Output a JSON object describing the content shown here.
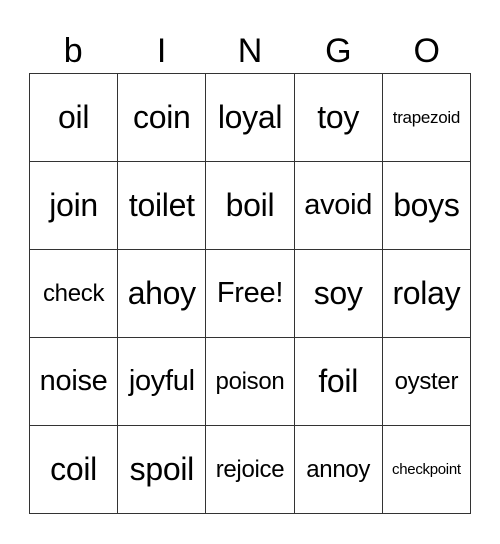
{
  "card": {
    "header": [
      "b",
      "I",
      "N",
      "G",
      "O"
    ],
    "rows": [
      [
        {
          "text": "oil",
          "size": "lg"
        },
        {
          "text": "coin",
          "size": "lg"
        },
        {
          "text": "loyal",
          "size": "lg"
        },
        {
          "text": "toy",
          "size": "lg"
        },
        {
          "text": "trapezoid",
          "size": "xs"
        }
      ],
      [
        {
          "text": "join",
          "size": "lg"
        },
        {
          "text": "toilet",
          "size": "lg"
        },
        {
          "text": "boil",
          "size": "lg"
        },
        {
          "text": "avoid",
          "size": "md"
        },
        {
          "text": "boys",
          "size": "lg"
        }
      ],
      [
        {
          "text": "check",
          "size": "sm"
        },
        {
          "text": "ahoy",
          "size": "lg"
        },
        {
          "text": "Free!",
          "size": "md"
        },
        {
          "text": "soy",
          "size": "lg"
        },
        {
          "text": "rolay",
          "size": "lg"
        }
      ],
      [
        {
          "text": "noise",
          "size": "md"
        },
        {
          "text": "joyful",
          "size": "md"
        },
        {
          "text": "poison",
          "size": "sm"
        },
        {
          "text": "foil",
          "size": "lg"
        },
        {
          "text": "oyster",
          "size": "sm"
        }
      ],
      [
        {
          "text": "coil",
          "size": "lg"
        },
        {
          "text": "spoil",
          "size": "lg"
        },
        {
          "text": "rejoice",
          "size": "sm"
        },
        {
          "text": "annoy",
          "size": "sm"
        },
        {
          "text": "checkpoint",
          "size": "xxs"
        }
      ]
    ]
  }
}
